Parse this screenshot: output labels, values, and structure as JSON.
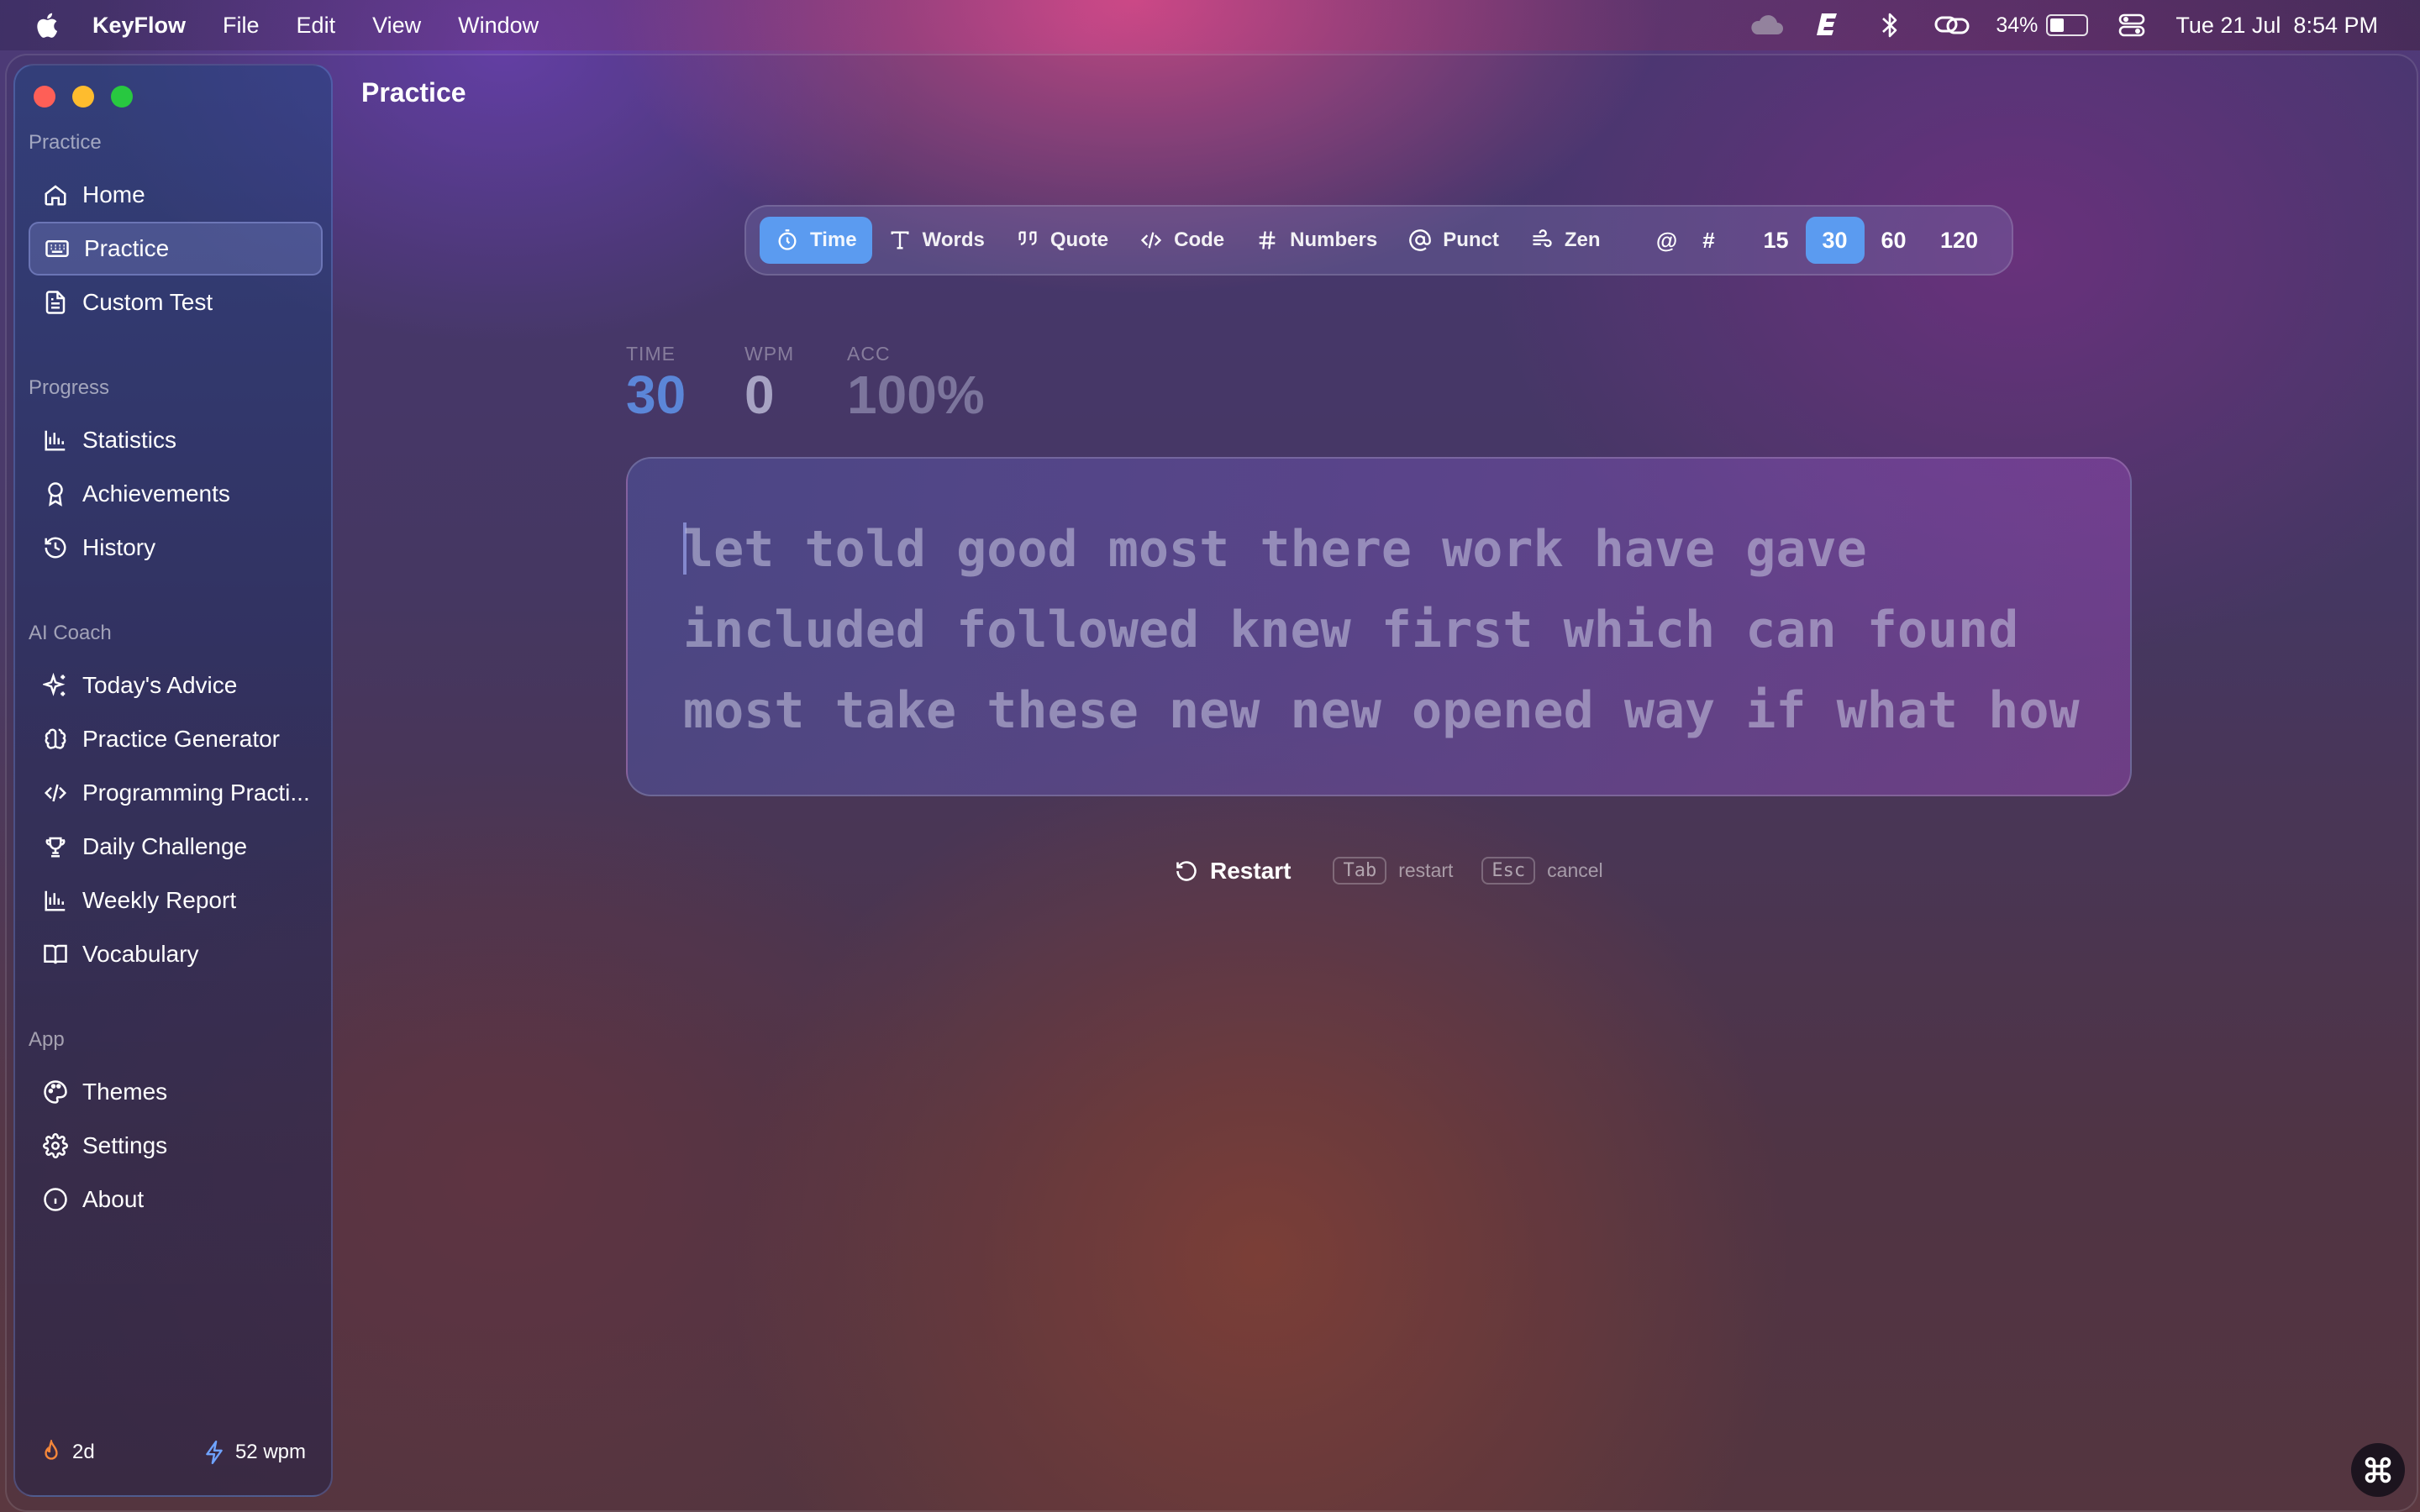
{
  "menubar": {
    "app_name": "KeyFlow",
    "menus": [
      "File",
      "Edit",
      "View",
      "Window"
    ],
    "battery_percent": "34%",
    "battery_level": 0.34,
    "datetime": "Tue 21 Jul  8:54 PM",
    "status_icons": [
      "cloud-icon",
      "e-app-icon",
      "bluetooth-icon",
      "link-icon",
      "battery-icon",
      "control-center-icon"
    ]
  },
  "sidebar": {
    "sections": [
      {
        "label": "Practice",
        "items": [
          {
            "label": "Home",
            "icon": "home-icon"
          },
          {
            "label": "Practice",
            "icon": "keyboard-icon",
            "active": true
          },
          {
            "label": "Custom Test",
            "icon": "document-icon"
          }
        ]
      },
      {
        "label": "Progress",
        "items": [
          {
            "label": "Statistics",
            "icon": "bar-chart-icon"
          },
          {
            "label": "Achievements",
            "icon": "award-icon"
          },
          {
            "label": "History",
            "icon": "history-icon"
          }
        ]
      },
      {
        "label": "AI Coach",
        "items": [
          {
            "label": "Today's Advice",
            "icon": "sparkles-icon"
          },
          {
            "label": "Practice Generator",
            "icon": "brain-icon"
          },
          {
            "label": "Programming Practi...",
            "icon": "code-icon"
          },
          {
            "label": "Daily Challenge",
            "icon": "trophy-icon"
          },
          {
            "label": "Weekly Report",
            "icon": "bar-chart-icon"
          },
          {
            "label": "Vocabulary",
            "icon": "book-icon"
          }
        ]
      },
      {
        "label": "App",
        "items": [
          {
            "label": "Themes",
            "icon": "palette-icon"
          },
          {
            "label": "Settings",
            "icon": "gear-icon"
          },
          {
            "label": "About",
            "icon": "info-icon"
          }
        ]
      }
    ],
    "footer": {
      "streak": "2d",
      "speed": "52 wpm"
    }
  },
  "page": {
    "title": "Practice"
  },
  "modes": {
    "items": [
      {
        "label": "Time",
        "icon": "stopwatch-icon",
        "active": true
      },
      {
        "label": "Words",
        "icon": "text-icon"
      },
      {
        "label": "Quote",
        "icon": "quote-icon"
      },
      {
        "label": "Code",
        "icon": "code-icon"
      },
      {
        "label": "Numbers",
        "icon": "hash-icon"
      },
      {
        "label": "Punct",
        "icon": "at-icon"
      },
      {
        "label": "Zen",
        "icon": "wind-icon"
      }
    ],
    "options": [
      "@",
      "#"
    ],
    "durations": [
      {
        "label": "15"
      },
      {
        "label": "30",
        "active": true
      },
      {
        "label": "60"
      },
      {
        "label": "120"
      }
    ]
  },
  "stats": {
    "time_label": "TIME",
    "time_value": "30",
    "wpm_label": "WPM",
    "wpm_value": "0",
    "acc_label": "ACC",
    "acc_value": "100%",
    "time_color": "#5b86d8"
  },
  "typing": {
    "lines": [
      "let told good most there work have gave",
      "included followed knew first which can found",
      "most take these new new opened way if what how"
    ]
  },
  "hints": {
    "restart_label": "Restart",
    "tab_key": "Tab",
    "tab_desc": "restart",
    "esc_key": "Esc",
    "esc_desc": "cancel"
  },
  "colors": {
    "accent": "#5b9bf0",
    "close": "#fe5f57",
    "minimize": "#febc2e",
    "zoom": "#28c840"
  }
}
